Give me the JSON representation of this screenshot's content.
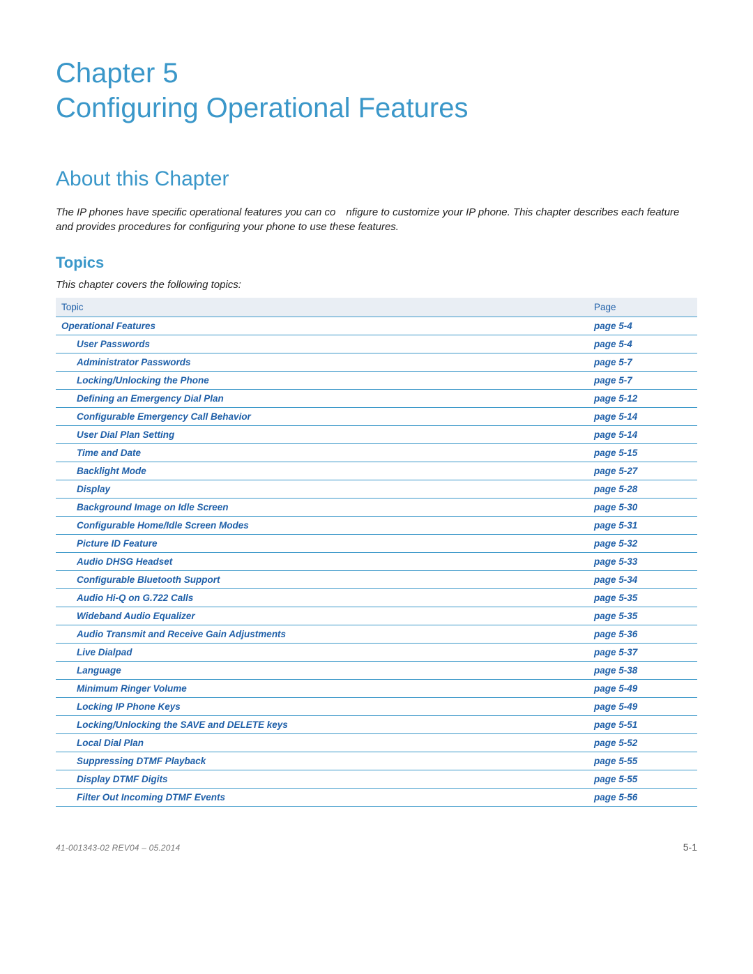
{
  "chapter": {
    "line1": "Chapter 5",
    "line2": "Configuring Operational Features"
  },
  "section": {
    "heading": "About this Chapter",
    "intro": "The IP phones have specific operational features you can co nfigure to customize your IP phone. This chapter describes each feature and provides procedures for configuring your phone to use these features."
  },
  "topics_section": {
    "heading": "Topics",
    "intro": "This chapter covers the following topics:",
    "col_topic": "Topic",
    "col_page": "Page"
  },
  "topics": [
    {
      "title": "Operational Features",
      "page": "page 5-4",
      "indent": false
    },
    {
      "title": "User Passwords",
      "page": "page 5-4",
      "indent": true
    },
    {
      "title": "Administrator Passwords",
      "page": "page 5-7",
      "indent": true
    },
    {
      "title": "Locking/Unlocking the Phone",
      "page": "page 5-7",
      "indent": true
    },
    {
      "title": "Defining an Emergency Dial Plan",
      "page": "page 5-12",
      "indent": true
    },
    {
      "title": "Configurable Emergency Call Behavior",
      "page": "page 5-14",
      "indent": true
    },
    {
      "title": "User Dial Plan Setting",
      "page": "page 5-14",
      "indent": true
    },
    {
      "title": "Time and Date",
      "page": "page 5-15",
      "indent": true
    },
    {
      "title": "Backlight Mode",
      "page": "page 5-27",
      "indent": true
    },
    {
      "title": "Display",
      "page": "page 5-28",
      "indent": true
    },
    {
      "title": "Background Image on Idle Screen",
      "page": "page 5-30",
      "indent": true
    },
    {
      "title": "Configurable Home/Idle Screen Modes",
      "page": "page 5-31",
      "indent": true
    },
    {
      "title": "Picture ID Feature",
      "page": "page 5-32",
      "indent": true
    },
    {
      "title": "Audio DHSG Headset",
      "page": "page 5-33",
      "indent": true
    },
    {
      "title": "Configurable Bluetooth Support",
      "page": "page 5-34",
      "indent": true
    },
    {
      "title": "Audio Hi-Q on G.722 Calls",
      "page": "page 5-35",
      "indent": true
    },
    {
      "title": "Wideband Audio Equalizer",
      "page": "page 5-35",
      "indent": true
    },
    {
      "title": "Audio Transmit and Receive Gain Adjustments",
      "page": "page 5-36",
      "indent": true
    },
    {
      "title": "Live Dialpad",
      "page": "page 5-37",
      "indent": true
    },
    {
      "title": "Language",
      "page": "page 5-38",
      "indent": true
    },
    {
      "title": "Minimum Ringer Volume",
      "page": "page 5-49",
      "indent": true
    },
    {
      "title": "Locking IP Phone Keys",
      "page": "page 5-49",
      "indent": true
    },
    {
      "title": "Locking/Unlocking the SAVE and DELETE keys",
      "page": "page 5-51",
      "indent": true
    },
    {
      "title": "Local Dial Plan",
      "page": "page 5-52",
      "indent": true
    },
    {
      "title": "Suppressing DTMF Playback",
      "page": "page 5-55",
      "indent": true
    },
    {
      "title": "Display DTMF Digits",
      "page": "page 5-55",
      "indent": true
    },
    {
      "title": "Filter Out Incoming DTMF Events",
      "page": "page 5-56",
      "indent": true
    }
  ],
  "footer": {
    "left": "41-001343-02 REV04 – 05.2014",
    "right": "5-1"
  }
}
